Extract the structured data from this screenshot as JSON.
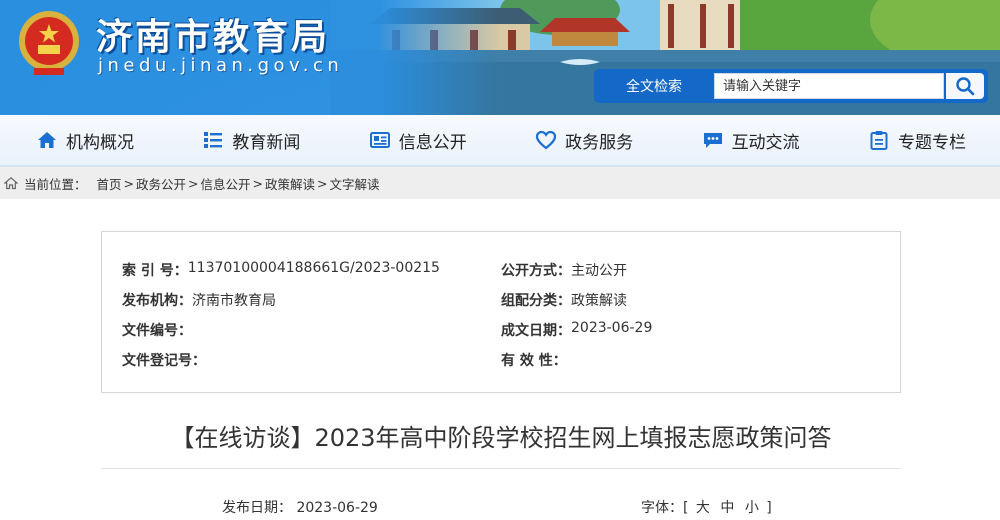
{
  "header": {
    "site_title": "济南市教育局",
    "site_domain": "jnedu.jinan.gov.cn",
    "search": {
      "label": "全文检索",
      "placeholder": "请输入关键字"
    }
  },
  "nav": {
    "items": [
      {
        "label": "机构概况",
        "icon": "home-icon"
      },
      {
        "label": "教育新闻",
        "icon": "list-icon"
      },
      {
        "label": "信息公开",
        "icon": "newspaper-icon"
      },
      {
        "label": "政务服务",
        "icon": "heart-icon"
      },
      {
        "label": "互动交流",
        "icon": "chat-icon"
      },
      {
        "label": "专题专栏",
        "icon": "clipboard-icon"
      }
    ]
  },
  "breadcrumb": {
    "label": "当前位置：",
    "items": [
      "首页",
      "政务公开",
      "信息公开",
      "政策解读",
      "文字解读"
    ],
    "separator": ">"
  },
  "info": {
    "index_key": "索 引 号：",
    "index_val": "11370100004188661G/2023-00215",
    "publisher_key": "发布机构：",
    "publisher_val": "济南市教育局",
    "doc_no_key": "文件编号：",
    "doc_no_val": "",
    "reg_no_key": "文件登记号：",
    "reg_no_val": "",
    "open_mode_key": "公开方式：",
    "open_mode_val": "主动公开",
    "category_key": "组配分类：",
    "category_val": "政策解读",
    "date_key": "成文日期：",
    "date_val": "2023-06-29",
    "validity_key": "有 效 性：",
    "validity_val": ""
  },
  "article": {
    "title": "【在线访谈】2023年高中阶段学校招生网上填报志愿政策问答",
    "publish_date_label": "发布日期：",
    "publish_date": "2023-06-29",
    "font_label": "字体：[",
    "font_sizes": [
      "大",
      "中",
      "小"
    ],
    "font_close": "]"
  },
  "colors": {
    "banner_blue": "#2b8fe0",
    "search_blue": "#1468c7",
    "nav_icon_blue": "#1a6fd0",
    "breadcrumb_bg": "#eeeeee"
  }
}
